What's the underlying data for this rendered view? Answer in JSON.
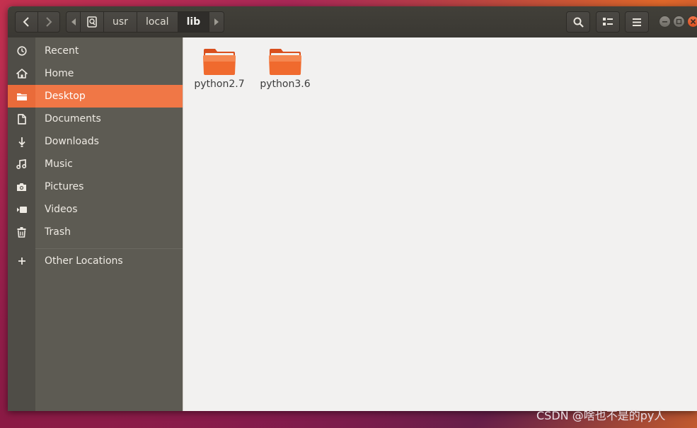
{
  "breadcrumb": {
    "segments": [
      "usr",
      "local",
      "lib"
    ],
    "current": "lib"
  },
  "sidebar": {
    "items": [
      {
        "label": "Recent",
        "icon": "clock-icon"
      },
      {
        "label": "Home",
        "icon": "home-icon"
      },
      {
        "label": "Desktop",
        "icon": "folder-icon",
        "active": true
      },
      {
        "label": "Documents",
        "icon": "document-icon"
      },
      {
        "label": "Downloads",
        "icon": "download-icon"
      },
      {
        "label": "Music",
        "icon": "music-icon"
      },
      {
        "label": "Pictures",
        "icon": "camera-icon"
      },
      {
        "label": "Videos",
        "icon": "video-icon"
      },
      {
        "label": "Trash",
        "icon": "trash-icon"
      }
    ],
    "other": {
      "label": "Other Locations",
      "icon": "plus-icon"
    }
  },
  "files": [
    {
      "name": "python2.7",
      "icon": "folder-icon"
    },
    {
      "name": "python3.6",
      "icon": "folder-icon"
    }
  ],
  "toolbar": {
    "search_icon": "search-icon",
    "view_icon": "list-view-icon",
    "menu_icon": "hamburger-menu-icon"
  },
  "colors": {
    "accent": "#f07746",
    "sidebar_bg": "#5d5b53",
    "headerbar_bg": "#3c3b37",
    "close_button": "#e0562a"
  },
  "watermark": "CSDN @啥也不是的py人"
}
